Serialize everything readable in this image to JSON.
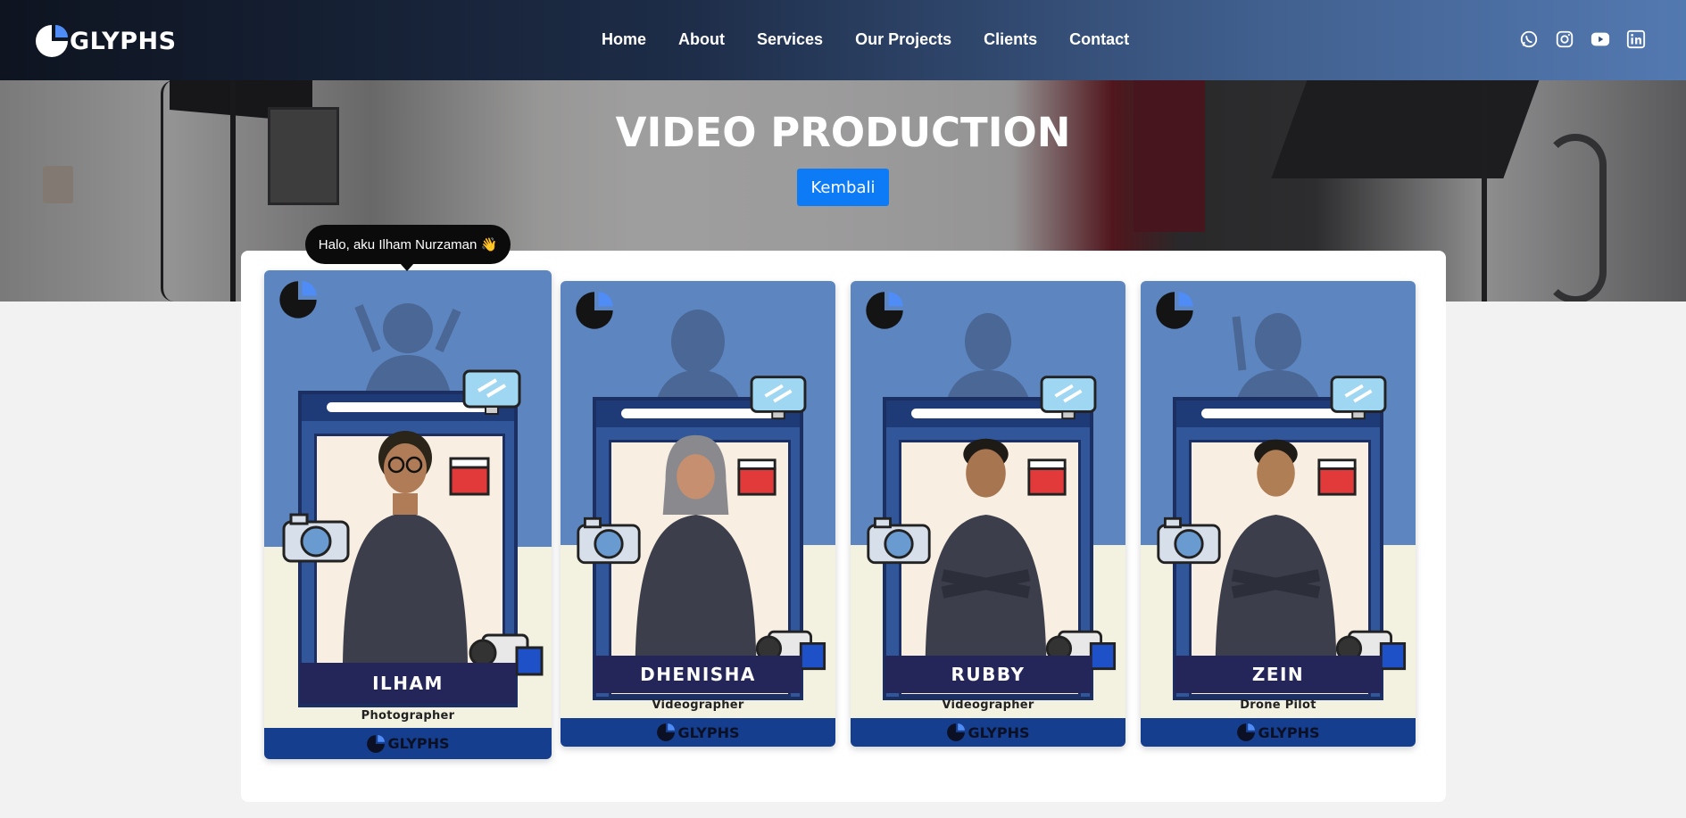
{
  "brand": {
    "name": "GLYPHS"
  },
  "nav": {
    "items": [
      "Home",
      "About",
      "Services",
      "Our Projects",
      "Clients",
      "Contact"
    ]
  },
  "socials": [
    "whatsapp-icon",
    "instagram-icon",
    "youtube-icon",
    "linkedin-icon"
  ],
  "hero": {
    "title": "VIDEO PRODUCTION",
    "back_button": "Kembali"
  },
  "tooltip": {
    "text": "Halo, aku Ilham Nurzaman 👋"
  },
  "team": [
    {
      "name": "ILHAM",
      "role": "Photographer",
      "footer": "GLYPHS"
    },
    {
      "name": "DHENISHA",
      "role": "Videographer",
      "footer": "GLYPHS"
    },
    {
      "name": "RUBBY",
      "role": "Videographer",
      "footer": "GLYPHS"
    },
    {
      "name": "ZEIN",
      "role": "Drone Pilot",
      "footer": "GLYPHS"
    }
  ],
  "colors": {
    "accent_button": "#0d7bf6",
    "card_top": "#5d86c0",
    "card_bottom": "#f3f1e0",
    "card_footer": "#163e8e",
    "name_plate": "#24265a"
  }
}
